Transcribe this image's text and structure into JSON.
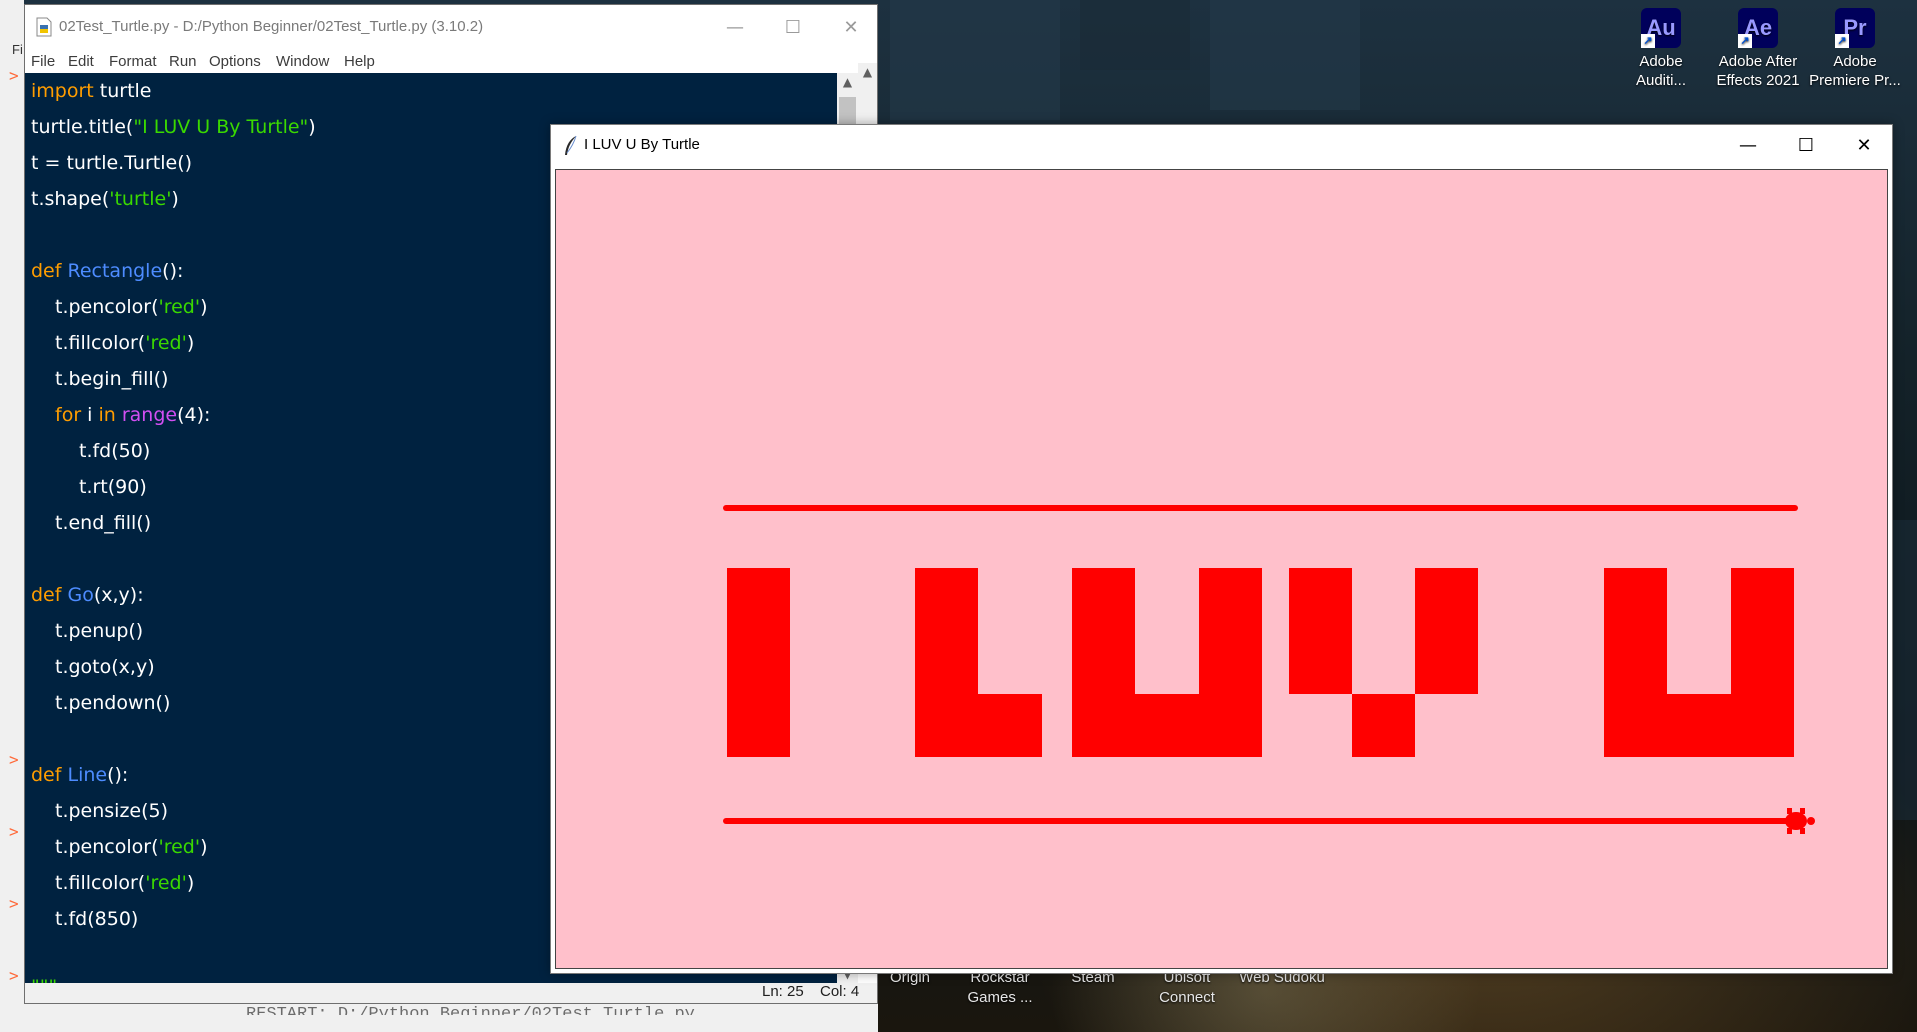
{
  "desktop": {
    "icons": [
      {
        "abbr": "Au",
        "label_line1": "Adobe",
        "label_line2": "Auditi..."
      },
      {
        "abbr": "Ae",
        "label_line1": "Adobe After",
        "label_line2": "Effects 2021"
      },
      {
        "abbr": "Pr",
        "label_line1": "Adobe",
        "label_line2": "Premiere Pr..."
      }
    ],
    "taskbar_items": [
      {
        "line1": "Origin",
        "line2": ""
      },
      {
        "line1": "Rockstar",
        "line2": "Games ..."
      },
      {
        "line1": "Steam",
        "line2": ""
      },
      {
        "line1": "Ubisoft",
        "line2": "Connect"
      },
      {
        "line1": "Web Sudoku",
        "line2": ""
      }
    ]
  },
  "shell": {
    "bottom_text": "RESTART: D:/Python Beginner/02Test_Turtle.py",
    "left_label": "Fi",
    "prompt": ">"
  },
  "editor": {
    "title": "02Test_Turtle.py - D:/Python Beginner/02Test_Turtle.py (3.10.2)",
    "menu": [
      "File",
      "Edit",
      "Format",
      "Run",
      "Options",
      "Window",
      "Help"
    ],
    "status": {
      "ln": "Ln: 25",
      "col": "Col: 4"
    },
    "code": {
      "l1_kw": "import",
      "l1_rest": " turtle",
      "l2_a": "turtle.title(",
      "l2_str": "\"I LUV U By Turtle\"",
      "l2_b": ")",
      "l3": "t = turtle.Turtle()",
      "l4_a": "t.shape(",
      "l4_str": "'turtle'",
      "l4_b": ")",
      "l6_kw": "def",
      "l6_fn": "Rectangle",
      "l6_b": "():",
      "l7_a": "t.pencolor(",
      "l7_str": "'red'",
      "l7_b": ")",
      "l8_a": "t.fillcolor(",
      "l8_str": "'red'",
      "l8_b": ")",
      "l9": "t.begin_fill()",
      "l10_kw1": "for",
      "l10_mid": " i ",
      "l10_kw2": "in",
      "l10_bi": " range",
      "l10_b": "(4):",
      "l11": "t.fd(50)",
      "l12": "t.rt(90)",
      "l13": "t.end_fill()",
      "l15_kw": "def",
      "l15_fn": "Go",
      "l15_b": "(x,y):",
      "l16": "t.penup()",
      "l17": "t.goto(x,y)",
      "l18": "t.pendown()",
      "l20_kw": "def",
      "l20_fn": "Line",
      "l20_b": "():",
      "l21": "t.pensize(5)",
      "l22_a": "t.pencolor(",
      "l22_str": "'red'",
      "l22_b": ")",
      "l23_a": "t.fillcolor(",
      "l23_str": "'red'",
      "l23_b": ")",
      "l24": "t.fd(850)",
      "l26": "\"\"\""
    }
  },
  "turtle_window": {
    "title": "I LUV U By Turtle",
    "canvas_color": "#ffc0cb",
    "ink_color": "#ff0000"
  },
  "colors": {
    "code_bg": "#002240",
    "keyword": "#ff9d00",
    "function": "#4d8cff",
    "string": "#3ad900",
    "builtin": "#d24ff2"
  }
}
